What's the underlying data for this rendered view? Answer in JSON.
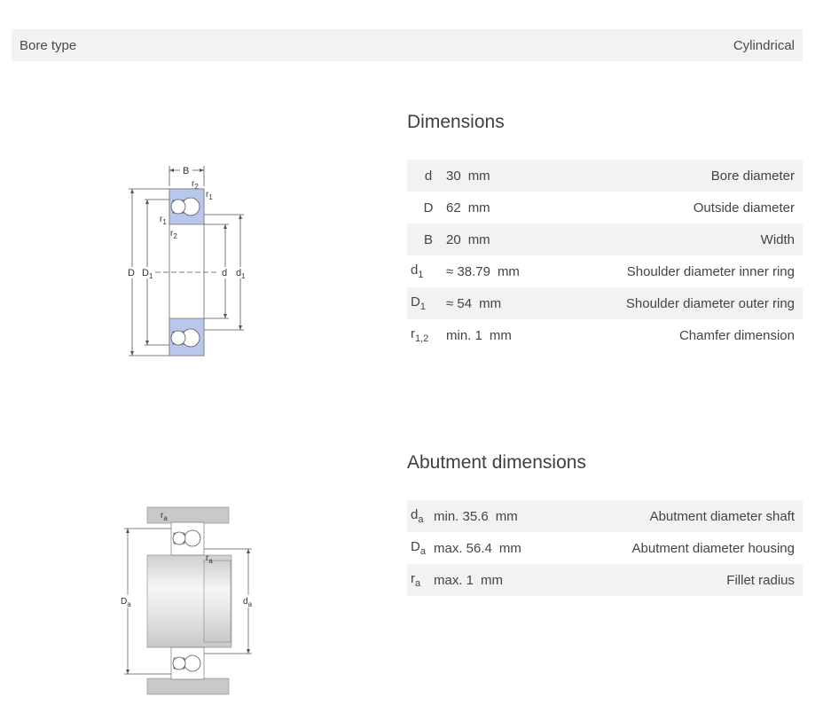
{
  "bore": {
    "label": "Bore type",
    "value": "Cylindrical"
  },
  "dimensions": {
    "title": "Dimensions",
    "rows": [
      {
        "sym": "d",
        "sub": "",
        "value": "30",
        "unit": "mm",
        "desc": "Bore diameter"
      },
      {
        "sym": "D",
        "sub": "",
        "value": "62",
        "unit": "mm",
        "desc": "Outside diameter"
      },
      {
        "sym": "B",
        "sub": "",
        "value": "20",
        "unit": "mm",
        "desc": "Width"
      },
      {
        "sym": "d",
        "sub": "1",
        "value": "≈ 38.79",
        "unit": "mm",
        "desc": "Shoulder diameter inner ring"
      },
      {
        "sym": "D",
        "sub": "1",
        "value": "≈ 54",
        "unit": "mm",
        "desc": "Shoulder diameter outer ring"
      },
      {
        "sym": "r",
        "sub": "1,2",
        "value": "min. 1",
        "unit": "mm",
        "desc": "Chamfer dimension"
      }
    ]
  },
  "abutment": {
    "title": "Abutment dimensions",
    "rows": [
      {
        "sym": "d",
        "sub": "a",
        "value": "min. 35.6",
        "unit": "mm",
        "desc": "Abutment diameter shaft"
      },
      {
        "sym": "D",
        "sub": "a",
        "value": "max. 56.4",
        "unit": "mm",
        "desc": "Abutment diameter housing"
      },
      {
        "sym": "r",
        "sub": "a",
        "value": "max. 1",
        "unit": "mm",
        "desc": "Fillet radius"
      }
    ]
  },
  "diagram1": {
    "labels": {
      "B": "B",
      "r2": "r",
      "r2sub": "2",
      "r1": "r",
      "r1sub": "1",
      "D": "D",
      "D1": "D",
      "D1sub": "1",
      "d": "d",
      "d1": "d",
      "d1sub": "1"
    }
  },
  "diagram2": {
    "labels": {
      "ra": "r",
      "rasub": "a",
      "Da": "D",
      "Dasub": "a",
      "da": "d",
      "dasub": "a"
    }
  }
}
